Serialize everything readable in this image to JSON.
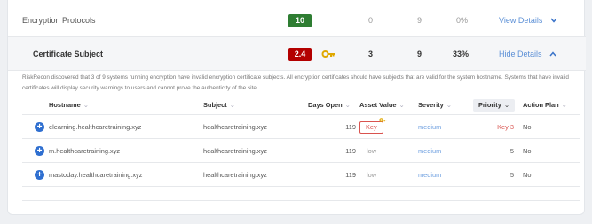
{
  "rows": {
    "protocols": {
      "title": "Encryption Protocols",
      "score": "10",
      "score_color": "#2e7d32",
      "col1": "0",
      "col2": "9",
      "pct": "0%",
      "action": "View Details",
      "action_icon": "chevron-down-icon"
    },
    "subject": {
      "title": "Certificate Subject",
      "score": "2.4",
      "score_color": "#b30000",
      "key_icon": "key-icon",
      "col1": "3",
      "col2": "9",
      "pct": "33%",
      "action": "Hide Details",
      "action_icon": "chevron-up-icon"
    }
  },
  "description": "RiskRecon discovered that 3 of 9 systems running encryption have invalid encryption certificate subjects. All encryption certificates should have subjects that are valid for the system hostname. Systems that have invalid certificates will display security warnings to users and cannot prove the authenticity of the site.",
  "table": {
    "headers": {
      "hostname": "Hostname",
      "subject": "Subject",
      "days_open": "Days Open",
      "asset_value": "Asset Value",
      "severity": "Severity",
      "priority": "Priority",
      "action_plan": "Action Plan"
    },
    "rows": [
      {
        "hostname": "elearning.healthcaretraining.xyz",
        "subject": "healthcaretraining.xyz",
        "days_open": "119",
        "asset_value": "Key",
        "severity": "medium",
        "priority": "Key 3",
        "action_plan": "No"
      },
      {
        "hostname": "m.healthcaretraining.xyz",
        "subject": "healthcaretraining.xyz",
        "days_open": "119",
        "asset_value": "low",
        "severity": "medium",
        "priority": "5",
        "action_plan": "No"
      },
      {
        "hostname": "mastoday.healthcaretraining.xyz",
        "subject": "healthcaretraining.xyz",
        "days_open": "119",
        "asset_value": "low",
        "severity": "medium",
        "priority": "5",
        "action_plan": "No"
      }
    ]
  },
  "colors": {
    "link": "#5b8fd6",
    "accent_blue": "#2f6fd0",
    "key_gold": "#e0a800",
    "key_red": "#d9534f"
  }
}
